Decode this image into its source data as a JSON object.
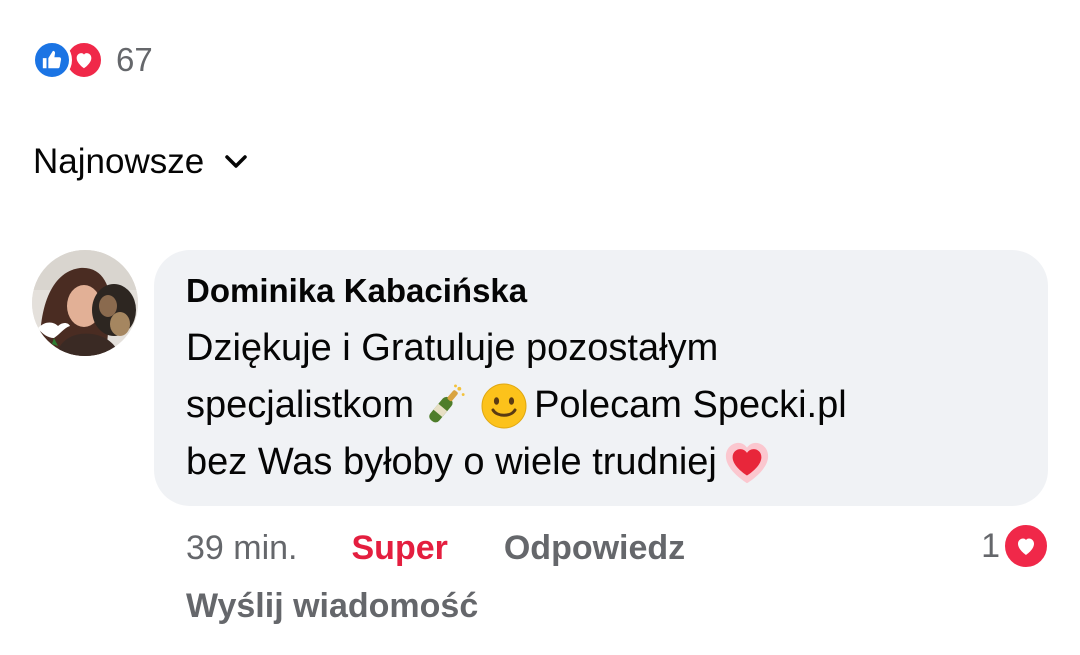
{
  "reactions": {
    "icons": [
      "like-icon",
      "love-icon"
    ],
    "count": "67",
    "colors": {
      "like": "#1b74e4",
      "love": "#f02849"
    }
  },
  "sort": {
    "label": "Najnowsze",
    "icon": "chevron-down-icon"
  },
  "comment": {
    "author": "Dominika Kabacińska",
    "lines": [
      {
        "text": "Dziękuje i Gratuluje pozostałym"
      },
      {
        "text_before": "specjalistkom",
        "emojis": [
          "champagne-icon",
          "smiley-icon"
        ],
        "text_after": "Polecam Specki.pl"
      },
      {
        "text": "bez Was byłoby o wiele trudniej",
        "emoji": "heart-icon"
      }
    ],
    "time": "39 min.",
    "react_label": "Super",
    "reply_label": "Odpowiedz",
    "message_label": "Wyślij wiadomość",
    "reaction_count": "1",
    "reaction_icon": "love-icon",
    "react_color": "#e41e3f"
  }
}
